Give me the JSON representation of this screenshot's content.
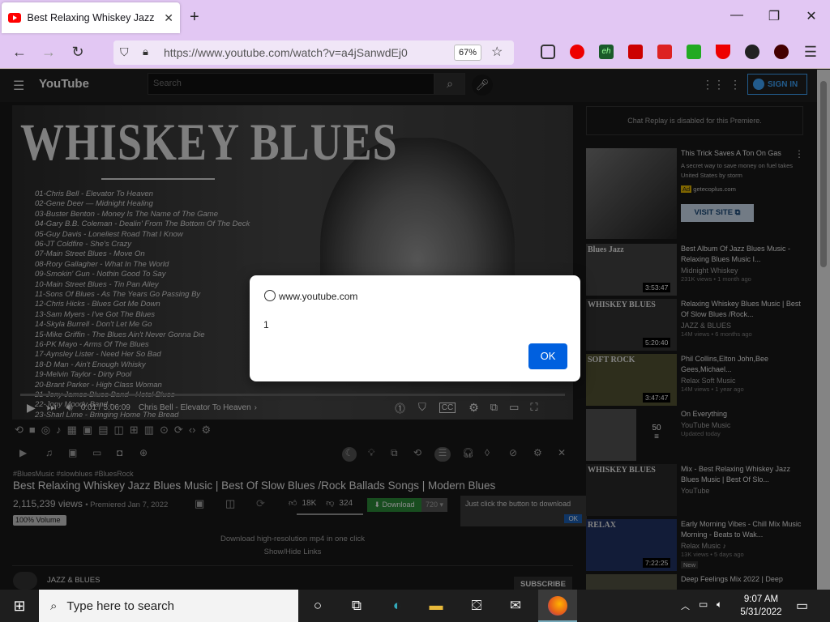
{
  "browser": {
    "tab_title": "Best Relaxing Whiskey Jazz Blue",
    "url": "https://www.youtube.com/watch?v=a4jSanwdEj0",
    "zoom": "67%"
  },
  "youtube": {
    "logo": "YouTube",
    "search_placeholder": "Search",
    "sign_in": "SIGN IN"
  },
  "video": {
    "thumb_title": "WHISKEY BLUES",
    "tracklist": [
      "01-Chris Bell - Elevator To Heaven",
      "02-Gene Deer — Midnight Healing",
      "03-Buster Benton - Money Is The Name of The Game",
      "04-Gary B.B. Coleman - Dealin' From The Bottom Of The Deck",
      "05-Guy Davis - Loneliest Road That I Know",
      "06-JT Coldfire - She's Crazy",
      "07-Main Street Blues - Move On",
      "08-Rory Gallagher - What In The World",
      "09-Smokin' Gun - Nothin Good To Say",
      "10-Main Street Blues - Tin Pan Alley",
      "11-Sons Of Blues - As The Years Go Passing By",
      "12-Chris Hicks - Blues Got Me Down",
      "13-Sam Myers - I've Got The Blues",
      "14-Skyla Burrell - Don't Let Me Go",
      "15-Mike Griffin - The Blues Ain't Never Gonna Die",
      "16-PK Mayo - Arms Of The Blues",
      "17-Aynsley Lister - Need Her So Bad",
      "18-D Man - Ain't Enough Whisky",
      "19-Melvin Taylor - Dirty Pool",
      "20-Brant Parker - High Class Woman",
      "21-Jony James Blues Band - Hotel Blues",
      "22-Jony Moody Band - ...",
      "23-Sharl Lime - Bringing Home The Bread"
    ],
    "time": "0:01 / 5:06:09",
    "chapter": "Chris Bell - Elevator To Heaven",
    "tags": "#BluesMusic #slowblues #BluesRock",
    "title": "Best Relaxing Whiskey Jazz Blues Music | Best Of Slow Blues /Rock Ballads Songs | Modern Blues",
    "views": "2,115,239 views",
    "premiered": "• Premiered Jan 7, 2022",
    "volume": "100% Volume",
    "likes": "18K",
    "dislikes": "324",
    "download": "Download",
    "quality": "720",
    "tooltip": "Just click the button to download",
    "tooltip_ok": "OK",
    "link1": "Download high-resolution mp4 in one click",
    "link2": "Show/Hide Links",
    "channel": "JAZZ & BLUES",
    "subscribe": "SUBSCRIBE"
  },
  "sidebar": {
    "chat_disabled": "Chat Replay is disabled for this Premiere.",
    "ad": {
      "title": "This Trick Saves A Ton On Gas",
      "desc": "A secret way to save money on fuel takes United States by storm",
      "badge": "Ad",
      "domain": "getecoplus.com",
      "visit": "VISIT SITE"
    },
    "items": [
      {
        "title": "Best Album Of Jazz Blues Music - Relaxing Blues Music I...",
        "channel": "Midnight Whiskey",
        "meta": "231K views • 1 month ago",
        "dur": "3:53:47",
        "thumb": "Blues Jazz"
      },
      {
        "title": "Relaxing Whiskey Blues Music | Best Of Slow Blues /Rock...",
        "channel": "JAZZ & BLUES",
        "meta": "14M views • 6 months ago",
        "dur": "5:20:40",
        "thumb": "WHISKEY BLUES"
      },
      {
        "title": "Phil Collins,Elton John,Bee Gees,Michael...",
        "channel": "Relax Soft Music",
        "meta": "14M views • 1 year ago",
        "dur": "3:47:47",
        "thumb": "SOFT ROCK"
      },
      {
        "title": "On Everything",
        "channel": "YouTube Music",
        "meta": "Updated today",
        "dur": "",
        "thumb": "",
        "count": "50"
      },
      {
        "title": "Mix - Best Relaxing Whiskey Jazz Blues Music | Best Of Slo...",
        "channel": "YouTube",
        "meta": "",
        "dur": "",
        "thumb": "WHISKEY BLUES"
      },
      {
        "title": "Early Morning Vibes - Chill Mix Music Morning - Beats to Wak...",
        "channel": "Relax Music ♪",
        "meta": "13K views • 5 days ago",
        "dur": "7:22:25",
        "thumb": "RELAX",
        "badge": "New"
      },
      {
        "title": "Deep Feelings Mix 2022 | Deep",
        "channel": "",
        "meta": "",
        "dur": "",
        "thumb": ""
      }
    ]
  },
  "dialog": {
    "host": "www.youtube.com",
    "message": "1",
    "ok": "OK"
  },
  "taskbar": {
    "search": "Type here to search",
    "time": "9:07 AM",
    "date": "5/31/2022"
  }
}
